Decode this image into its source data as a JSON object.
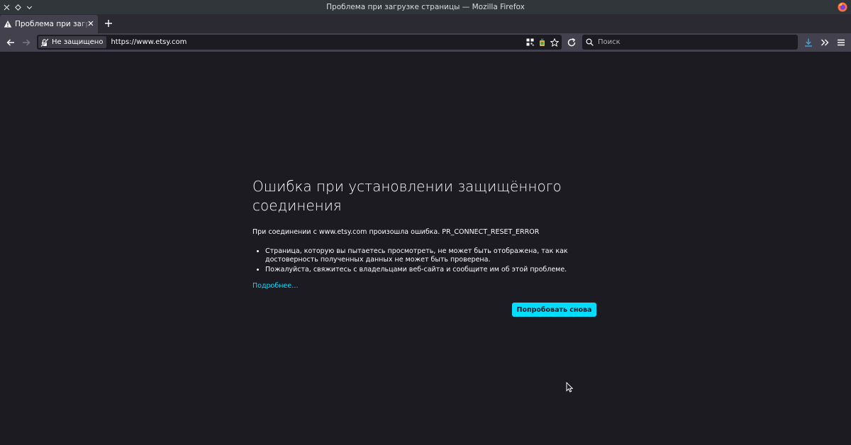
{
  "window": {
    "title": "Проблема при загрузке страницы — Mozilla Firefox"
  },
  "tabs": [
    {
      "label": "Проблема при загрузке страницы",
      "icon": "warning-icon",
      "active": true
    }
  ],
  "navbar": {
    "security_label": "Не защищено",
    "url": "https://www.etsy.com",
    "search_placeholder": "Поиск"
  },
  "error": {
    "title": "Ошибка при установлении защищённого соединения",
    "short_desc": "При соединении с www.etsy.com произошла ошибка. PR_CONNECT_RESET_ERROR",
    "bullets": [
      "Страница, которую вы пытаетесь просмотреть, не может быть отображена, так как достоверность полученных данных не может быть проверена.",
      "Пожалуйста, свяжитесь с владельцами веб-сайта и сообщите им об этой проблеме."
    ],
    "learn_more": "Подробнее…",
    "try_again": "Попробовать снова"
  },
  "colors": {
    "accent": "#00ddff",
    "background": "#1c1b22",
    "toolbar": "#42414d",
    "titlebar": "#31363b"
  }
}
